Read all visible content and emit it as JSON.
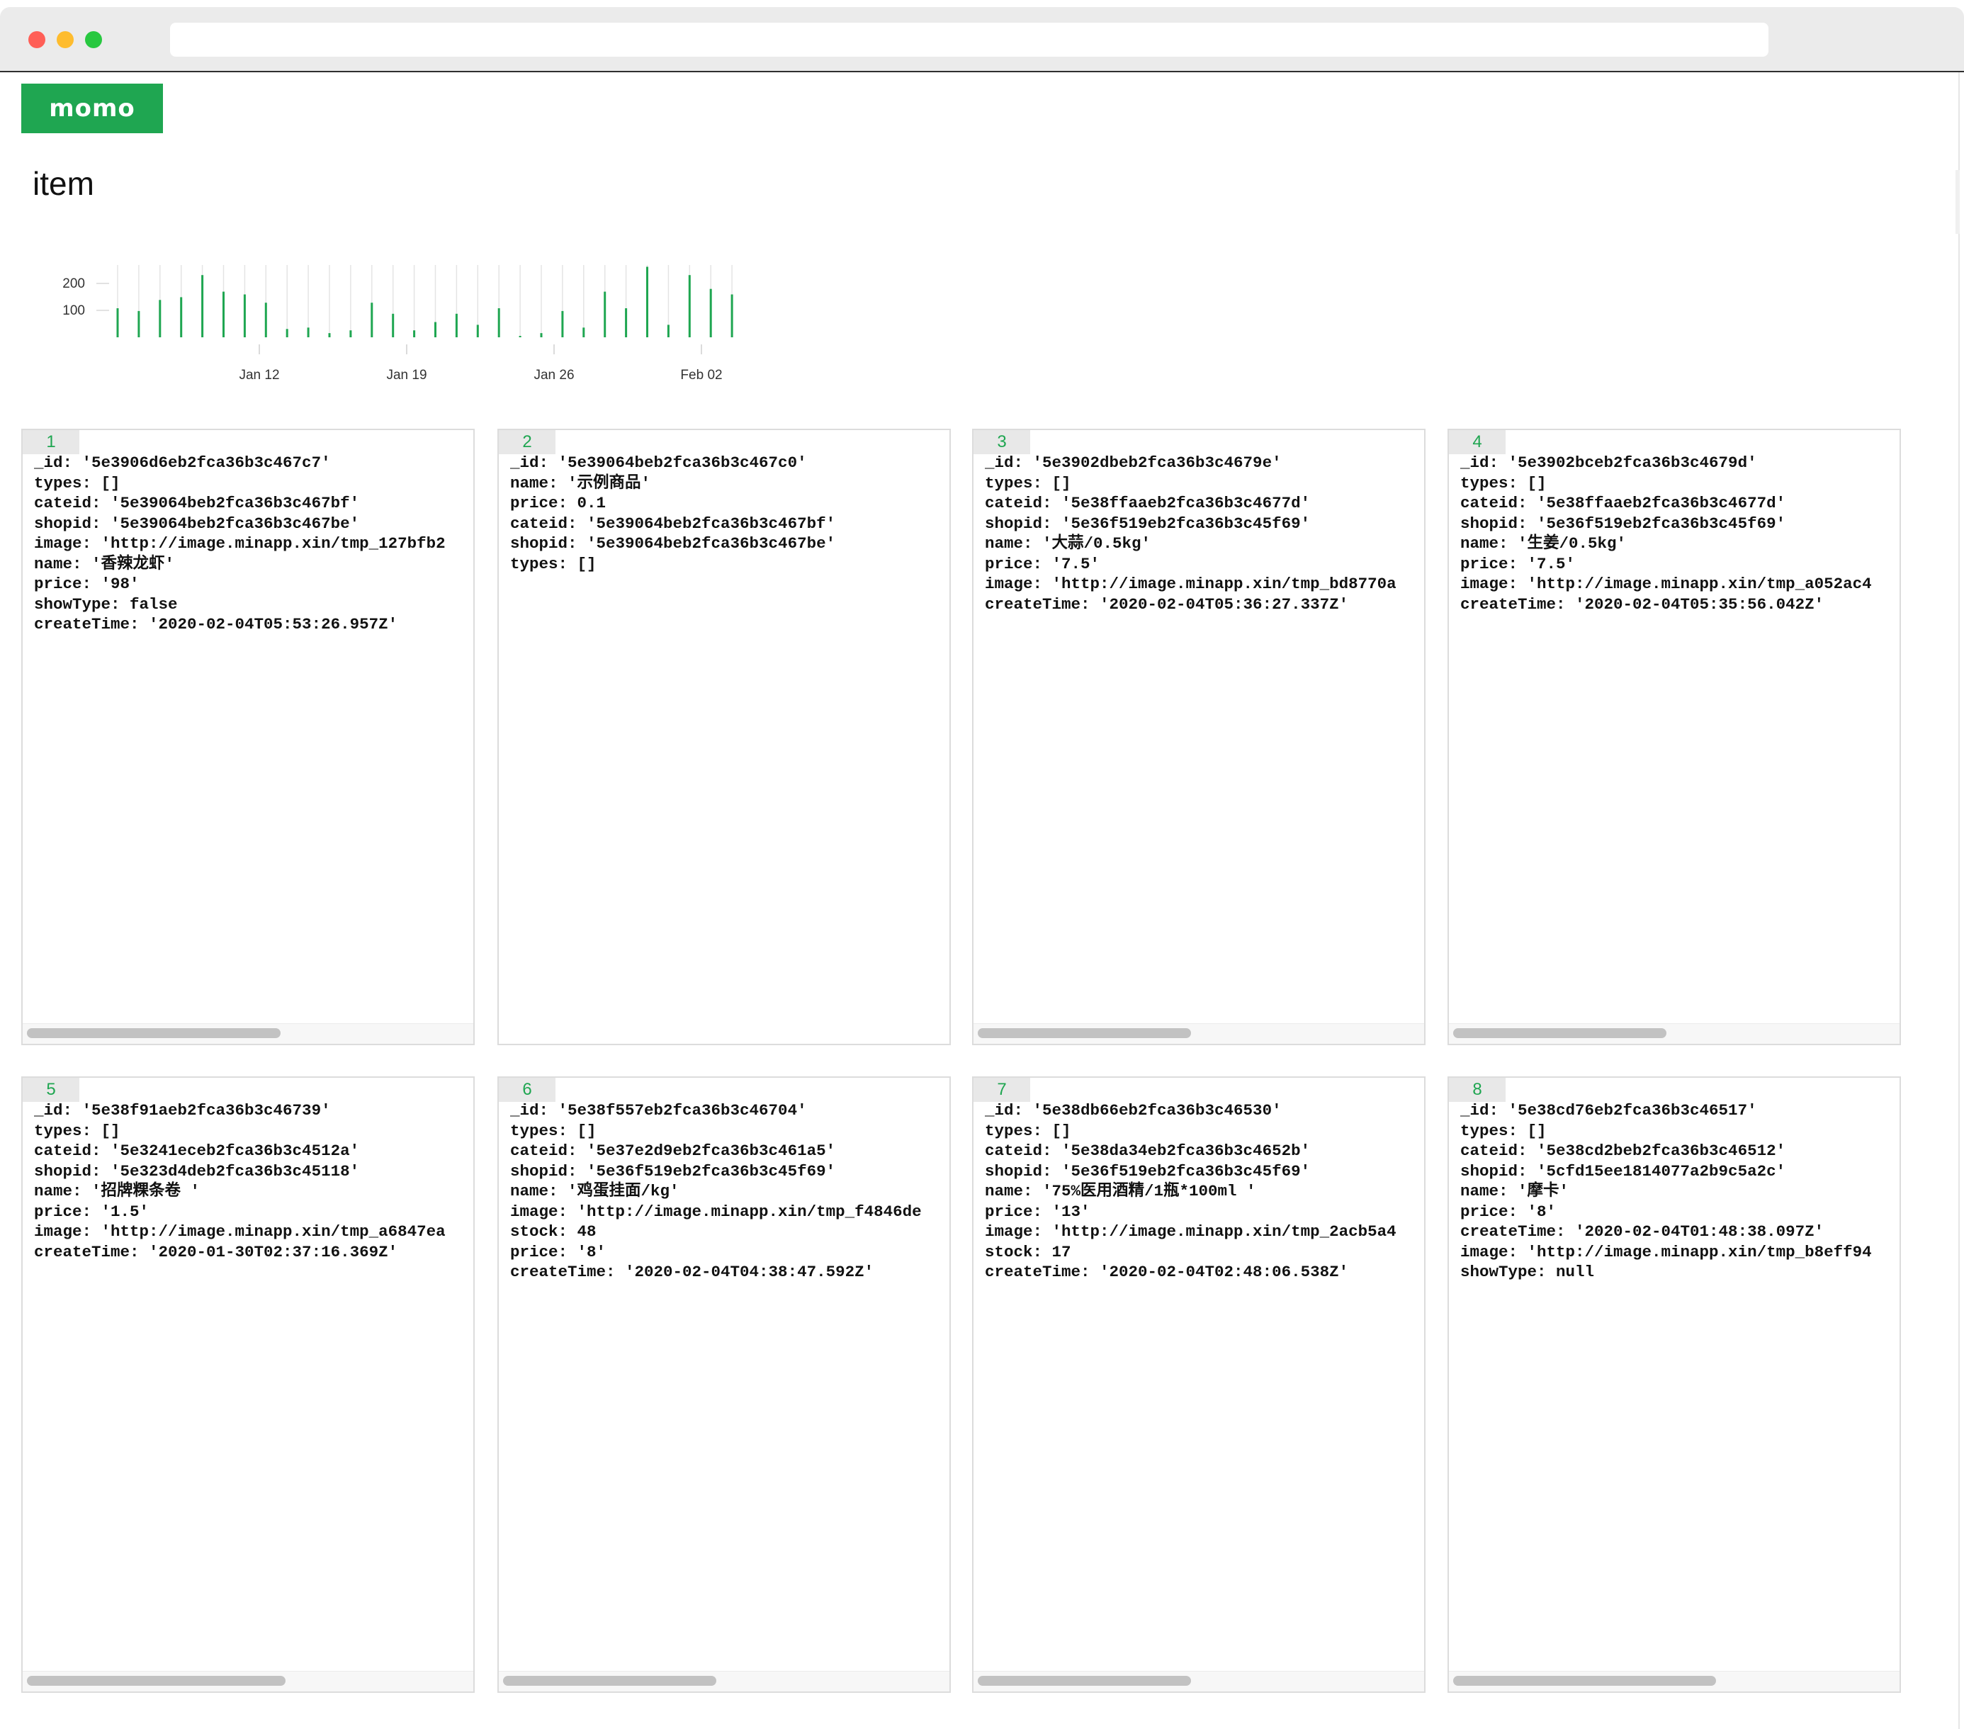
{
  "app": {
    "logo_text": "momo",
    "page_title": "item"
  },
  "colors": {
    "accent": "#1fa651",
    "bar": "#1fa651",
    "card_border": "#dcdcdc"
  },
  "chart_data": {
    "type": "bar",
    "y_ticks": [
      100,
      200
    ],
    "x_tick_labels": [
      "Jan 12",
      "Jan 19",
      "Jan 26",
      "Feb 02"
    ],
    "x_tick_indices": [
      7,
      14,
      21,
      28
    ],
    "ylim": [
      0,
      260
    ],
    "values": [
      100,
      90,
      130,
      140,
      220,
      160,
      150,
      120,
      25,
      30,
      10,
      20,
      120,
      80,
      20,
      50,
      80,
      40,
      100,
      0,
      10,
      90,
      30,
      160,
      100,
      250,
      40,
      220,
      170,
      150
    ],
    "grid": false
  },
  "cards": [
    {
      "num": "1",
      "thumb_frac": 0.56,
      "lines": [
        "_id: '5e3906d6eb2fca36b3c467c7'",
        "types: []",
        "cateid: '5e39064beb2fca36b3c467bf'",
        "shopid: '5e39064beb2fca36b3c467be'",
        "image: 'http://image.minapp.xin/tmp_127bfb2",
        "name: '香辣龙虾'",
        "price: '98'",
        "showType: false",
        "createTime: '2020-02-04T05:53:26.957Z'"
      ]
    },
    {
      "num": "2",
      "thumb_frac": 0,
      "lines": [
        "_id: '5e39064beb2fca36b3c467c0'",
        "name: '示例商品'",
        "price: 0.1",
        "cateid: '5e39064beb2fca36b3c467bf'",
        "shopid: '5e39064beb2fca36b3c467be'",
        "types: []"
      ]
    },
    {
      "num": "3",
      "thumb_frac": 0.47,
      "lines": [
        "_id: '5e3902dbeb2fca36b3c4679e'",
        "types: []",
        "cateid: '5e38ffaaeb2fca36b3c4677d'",
        "shopid: '5e36f519eb2fca36b3c45f69'",
        "name: '大蒜/0.5kg'",
        "price: '7.5'",
        "image: 'http://image.minapp.xin/tmp_bd8770a",
        "createTime: '2020-02-04T05:36:27.337Z'"
      ]
    },
    {
      "num": "4",
      "thumb_frac": 0.47,
      "lines": [
        "_id: '5e3902bceb2fca36b3c4679d'",
        "types: []",
        "cateid: '5e38ffaaeb2fca36b3c4677d'",
        "shopid: '5e36f519eb2fca36b3c45f69'",
        "name: '生姜/0.5kg'",
        "price: '7.5'",
        "image: 'http://image.minapp.xin/tmp_a052ac4",
        "createTime: '2020-02-04T05:35:56.042Z'"
      ]
    },
    {
      "num": "5",
      "thumb_frac": 0.57,
      "lines": [
        "_id: '5e38f91aeb2fca36b3c46739'",
        "types: []",
        "cateid: '5e3241eceb2fca36b3c4512a'",
        "shopid: '5e323d4deb2fca36b3c45118'",
        "name: '招牌粿条卷 '",
        "price: '1.5'",
        "image: 'http://image.minapp.xin/tmp_a6847ea",
        "createTime: '2020-01-30T02:37:16.369Z'"
      ]
    },
    {
      "num": "6",
      "thumb_frac": 0.47,
      "lines": [
        "_id: '5e38f557eb2fca36b3c46704'",
        "types: []",
        "cateid: '5e37e2d9eb2fca36b3c461a5'",
        "shopid: '5e36f519eb2fca36b3c45f69'",
        "name: '鸡蛋挂面/kg'",
        "image: 'http://image.minapp.xin/tmp_f4846de",
        "stock: 48",
        "price: '8'",
        "createTime: '2020-02-04T04:38:47.592Z'"
      ]
    },
    {
      "num": "7",
      "thumb_frac": 0.47,
      "lines": [
        "_id: '5e38db66eb2fca36b3c46530'",
        "types: []",
        "cateid: '5e38da34eb2fca36b3c4652b'",
        "shopid: '5e36f519eb2fca36b3c45f69'",
        "name: '75%医用酒精/1瓶*100ml '",
        "price: '13'",
        "image: 'http://image.minapp.xin/tmp_2acb5a4",
        "stock: 17",
        "createTime: '2020-02-04T02:48:06.538Z'"
      ]
    },
    {
      "num": "8",
      "thumb_frac": 0.58,
      "lines": [
        "_id: '5e38cd76eb2fca36b3c46517'",
        "types: []",
        "cateid: '5e38cd2beb2fca36b3c46512'",
        "shopid: '5cfd15ee1814077a2b9c5a2c'",
        "name: '摩卡'",
        "price: '8'",
        "createTime: '2020-02-04T01:48:38.097Z'",
        "image: 'http://image.minapp.xin/tmp_b8eff94",
        "showType: null"
      ]
    }
  ]
}
